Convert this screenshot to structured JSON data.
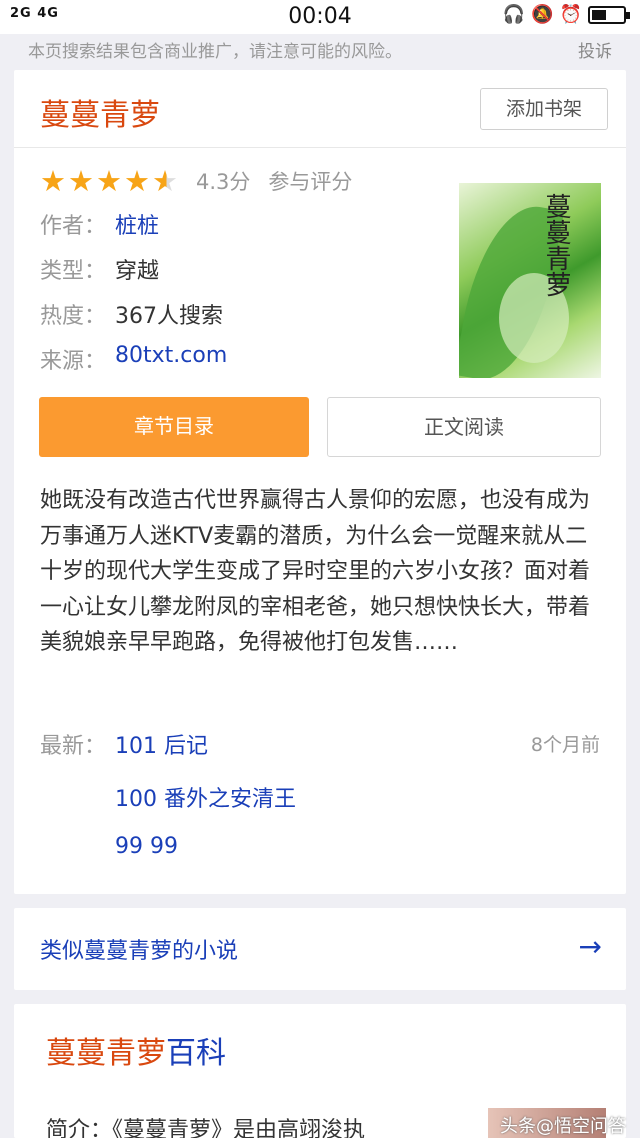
{
  "status_bar": {
    "signal": "2G 4G",
    "time": "00:04"
  },
  "notice": {
    "text": "本页搜索结果包含商业推广，请注意可能的风险。",
    "report": "投诉"
  },
  "book": {
    "title": "蔓蔓青萝",
    "bookmark_label": "添加书架",
    "rating": {
      "stars": 4.3,
      "score": "4.3分",
      "rate_label": "参与评分"
    },
    "info": [
      {
        "key": "作者：",
        "value": "桩桩"
      },
      {
        "key": "类型：",
        "value": "穿越"
      },
      {
        "key": "热度：",
        "value": "367人搜索"
      },
      {
        "key": "来源：",
        "value": "80txt.com"
      }
    ],
    "cover_title": "蔓蔓青萝",
    "toc_label": "章节目录",
    "read_label": "正文阅读",
    "summary": "她既没有改造古代世界赢得古人景仰的宏愿，也没有成为万事通万人迷KTV麦霸的潜质，为什么会一觉醒来就从二十岁的现代大学生变成了异时空里的六岁小女孩？面对着一心让女儿攀龙附凤的宰相老爸，她只想快快长大，带着美貌娘亲早早跑路，免得被他打包发售……",
    "latest_label": "最新：",
    "latest_time": "8个月前",
    "chapters": [
      "101 后记",
      "100 番外之安清王",
      "99 99"
    ]
  },
  "similar": {
    "label": "类似蔓蔓青萝的小说"
  },
  "baike": {
    "title_main": "蔓蔓青萝",
    "title_suffix": "百科",
    "intro": "简介：《蔓蔓青萝》是由高翊浚执"
  },
  "watermark": "头条@悟空问答"
}
